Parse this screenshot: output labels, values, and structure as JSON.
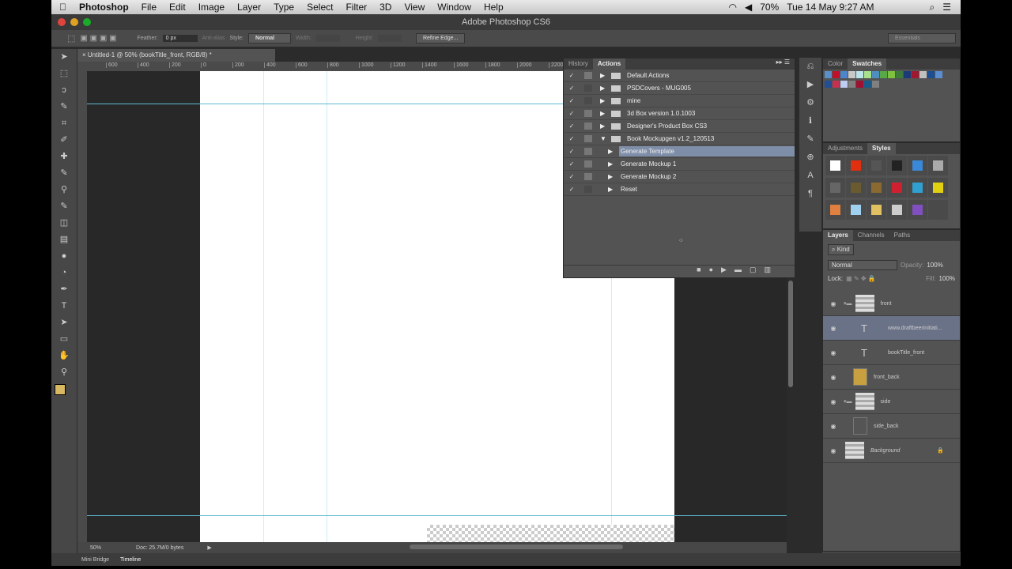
{
  "menubar": {
    "app": "Photoshop",
    "items": [
      "File",
      "Edit",
      "Image",
      "Layer",
      "Type",
      "Select",
      "Filter",
      "3D",
      "View",
      "Window",
      "Help"
    ],
    "battery": "70%",
    "datetime": "Tue 14 May  9:27 AM"
  },
  "window": {
    "title": "Adobe Photoshop CS6"
  },
  "options": {
    "feather_label": "Feather:",
    "feather": "0 px",
    "antialias": "Anti-alias",
    "style_label": "Style:",
    "style": "Normal",
    "width_label": "Width:",
    "height_label": "Height:",
    "refine": "Refine Edge...",
    "workspace": "Essentials"
  },
  "document": {
    "tab": "Untitled-1 @ 50% (bookTitle_front, RGB/8) *",
    "zoom": "50%",
    "doc": "Doc: 25.7M/0 bytes",
    "ruler": [
      "600",
      "400",
      "200",
      "0",
      "200",
      "400",
      "600",
      "800",
      "1000",
      "1200",
      "1400",
      "1600",
      "1800",
      "2000",
      "2200"
    ]
  },
  "actions": {
    "tabs": [
      "History",
      "Actions"
    ],
    "rows": [
      {
        "label": "Default Actions",
        "box": true,
        "level": 0
      },
      {
        "label": "PSDCovers - MUG005",
        "box": false,
        "level": 0
      },
      {
        "label": "mine",
        "box": false,
        "level": 0
      },
      {
        "label": "3d Box version 1.0.1003",
        "box": true,
        "level": 0
      },
      {
        "label": "Designer's Product Box CS3",
        "box": true,
        "level": 0
      },
      {
        "label": "Book Mockupgen v1.2_120513",
        "box": true,
        "level": 0,
        "open": true
      },
      {
        "label": "Generate Template",
        "box": true,
        "level": 1,
        "selected": true
      },
      {
        "label": "Generate Mockup 1",
        "box": true,
        "level": 1
      },
      {
        "label": "Generate Mockup 2",
        "box": true,
        "level": 1
      },
      {
        "label": "Reset",
        "box": false,
        "level": 1
      }
    ]
  },
  "swatches": {
    "tabs": [
      "Color",
      "Swatches"
    ],
    "colors": [
      "#5b8fc8",
      "#c0102a",
      "#4d84cc",
      "#c8c8c8",
      "#bde3ea",
      "#a8e08c",
      "#4f8fc0",
      "#58a848",
      "#80c040",
      "#3e7a3a",
      "#1c3a78",
      "#a01830",
      "#c0c0c0",
      "#1c4e94",
      "#5a8ed0",
      "#244e94",
      "#c83050",
      "#c0ccf0",
      "#808080",
      "#a01030",
      "#1c5a88",
      "#808080"
    ]
  },
  "styles": {
    "tabs": [
      "Adjustments",
      "Styles"
    ],
    "colors": [
      "#ffffff",
      "#e03010",
      "#555555",
      "#222222",
      "#3a88d8",
      "#aaaaaa",
      "#666666",
      "#6a5a30",
      "#8a6a30",
      "#d02030",
      "#30a0d0",
      "#e0d010",
      "#e08040",
      "#a0d0f0",
      "#e0c060",
      "#cccccc",
      "#8050c0",
      "#4a4a4a"
    ]
  },
  "layers": {
    "tabs": [
      "Layers",
      "Channels",
      "Paths"
    ],
    "kind": "Kind",
    "blend": "Normal",
    "opacity_label": "Opacity:",
    "opacity": "100%",
    "lock_label": "Lock:",
    "fill_label": "Fill:",
    "fill": "100%",
    "items": [
      {
        "name": "front",
        "type": "group"
      },
      {
        "name": "www.draftbeerinitiati...",
        "type": "text",
        "selected": true
      },
      {
        "name": "bookTitle_front",
        "type": "text"
      },
      {
        "name": "front_back",
        "type": "shape"
      },
      {
        "name": "side",
        "type": "group"
      },
      {
        "name": "side_back",
        "type": "shape"
      },
      {
        "name": "Background",
        "type": "image",
        "locked": true
      }
    ]
  },
  "bottom": {
    "tabs": [
      "Mini Bridge",
      "Timeline"
    ]
  }
}
